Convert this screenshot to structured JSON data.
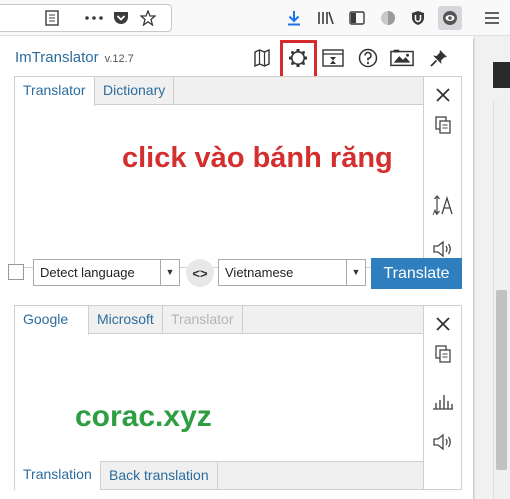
{
  "browser": {
    "icons": [
      "reader-view-icon",
      "more-icon",
      "pocket-icon",
      "bookmark-star-icon",
      "download-icon",
      "library-icon",
      "sidebar-icon",
      "extension-icon",
      "ublock-icon",
      "imtranslator-icon",
      "menu-icon"
    ]
  },
  "header": {
    "brand": "ImTranslator",
    "version": "v.12.7"
  },
  "source_panel": {
    "tabs": [
      "Translator",
      "Dictionary"
    ],
    "active_tab": "Translator"
  },
  "controls": {
    "source_language": "Detect language",
    "target_language": "Vietnamese",
    "translate_label": "Translate"
  },
  "result_panel": {
    "top_tabs": [
      "Google",
      "Microsoft",
      "Translator"
    ],
    "active_top_tab": "Google",
    "bottom_tabs": [
      "Translation",
      "Back translation"
    ],
    "active_bottom_tab": "Translation"
  },
  "annotations": {
    "instruction": "click vào bánh răng",
    "watermark": "corac.xyz",
    "highlight_color": "#d62b2b"
  },
  "colors": {
    "accent": "#2c6c9c",
    "button": "#2f7fbf"
  }
}
